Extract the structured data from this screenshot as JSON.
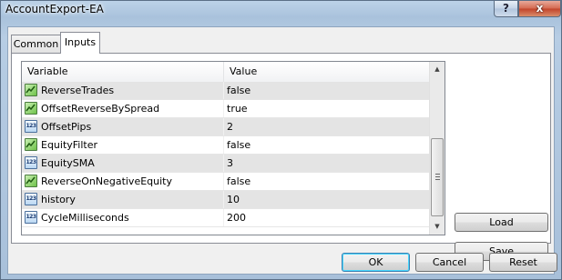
{
  "window": {
    "title": "AccountExport-EA",
    "help_label": "?",
    "close_label": "x"
  },
  "tabs": [
    {
      "label": "Common",
      "active": false
    },
    {
      "label": "Inputs",
      "active": true
    }
  ],
  "grid": {
    "columns": [
      "Variable",
      "Value"
    ],
    "rows": [
      {
        "icon": "bool-icon",
        "name": "ReverseTrades",
        "value": "false"
      },
      {
        "icon": "bool-icon",
        "name": "OffsetReverseBySpread",
        "value": "true"
      },
      {
        "icon": "number-icon",
        "name": "OffsetPips",
        "value": "2"
      },
      {
        "icon": "bool-icon",
        "name": "EquityFilter",
        "value": "false"
      },
      {
        "icon": "number-icon",
        "name": "EquitySMA",
        "value": "3"
      },
      {
        "icon": "bool-icon",
        "name": "ReverseOnNegativeEquity",
        "value": "false"
      },
      {
        "icon": "number-icon",
        "name": "history",
        "value": "10"
      },
      {
        "icon": "number-icon",
        "name": "CycleMilliseconds",
        "value": "200"
      }
    ],
    "number_icon_text": "123"
  },
  "side_buttons": {
    "load": "Load",
    "save": "Save"
  },
  "footer_buttons": {
    "ok": "OK",
    "cancel": "Cancel",
    "reset": "Reset"
  }
}
